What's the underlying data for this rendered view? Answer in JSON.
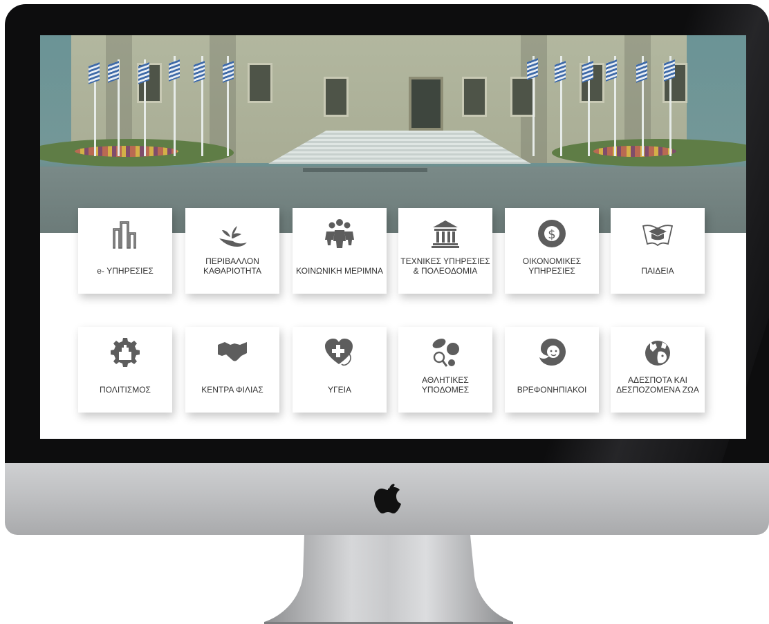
{
  "tiles_row1": [
    {
      "label": "e- ΥΠΗΡΕΣΙΕΣ",
      "icon": "buildings-icon"
    },
    {
      "label": "ΠΕΡΙΒΑΛΛΟΝ ΚΑΘΑΡΙΟΤΗΤΑ",
      "icon": "plant-hand-icon"
    },
    {
      "label": "ΚΟΙΝΩΝΙΚΗ ΜΕΡΙΜΝΑ",
      "icon": "people-group-icon"
    },
    {
      "label": "ΤΕΧΝΙΚΕΣ ΥΠΗΡΕΣΙΕΣ & ΠΟΛΕΟΔΟΜΙΑ",
      "icon": "columns-building-icon"
    },
    {
      "label": "ΟΙΚΟΝΟΜΙΚΕΣ ΥΠΗΡΕΣΙΕΣ",
      "icon": "globe-dollar-icon"
    },
    {
      "label": "ΠΑΙΔΕΙΑ",
      "icon": "graduation-book-icon"
    }
  ],
  "tiles_row2": [
    {
      "label": "ΠΟΛΙΤΙΣΜΟΣ",
      "icon": "gear-city-icon"
    },
    {
      "label": "ΚΕΝΤΡΑ ΦΙΛΙΑΣ",
      "icon": "handshake-icon"
    },
    {
      "label": "ΥΓΕΙΑ",
      "icon": "heart-cross-icon"
    },
    {
      "label": "ΑΘΛΗΤΙΚΕΣ ΥΠΟΔΟΜΕΣ",
      "icon": "sports-balls-icon"
    },
    {
      "label": "ΒΡΕΦΟΝΗΠΙΑΚΟΙ",
      "icon": "baby-face-icon"
    },
    {
      "label": "ΑΔΕΣΠΟΤΑ ΚΑΙ ΔΕΣΠΟΖΟΜΕΝΑ ΖΩΑ",
      "icon": "animals-globe-icon"
    }
  ],
  "colors": {
    "hero_tint": "#40767d",
    "icon_gray": "#5d5d5d",
    "bezel": "#0d0d0e",
    "chin_silver": "#c4c5c7"
  }
}
